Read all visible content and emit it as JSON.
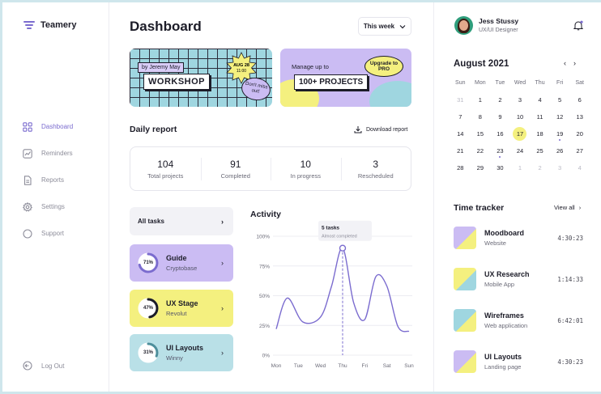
{
  "app": {
    "name": "Teamery"
  },
  "sidebar": {
    "items": [
      {
        "label": "Dashboard",
        "icon": "grid-icon"
      },
      {
        "label": "Reminders",
        "icon": "chart-icon"
      },
      {
        "label": "Reports",
        "icon": "document-icon"
      },
      {
        "label": "Settings",
        "icon": "gear-icon"
      },
      {
        "label": "Support",
        "icon": "chat-icon"
      }
    ],
    "logout_label": "Log Out"
  },
  "header": {
    "title": "Dashboard",
    "period": "This week"
  },
  "banners": {
    "workshop": {
      "by": "by Jeremy May",
      "tag": "WORKSHOP",
      "date": "AUG 28",
      "time": "11:00",
      "note": "Don't miss out!"
    },
    "pro": {
      "text": "Manage up to",
      "tag": "100+ PROJECTS",
      "cta": "Upgrade to PRO"
    }
  },
  "daily_report": {
    "title": "Daily report",
    "download_label": "Download report",
    "stats": [
      {
        "value": "104",
        "label": "Total projects"
      },
      {
        "value": "91",
        "label": "Completed"
      },
      {
        "value": "10",
        "label": "In progress"
      },
      {
        "value": "3",
        "label": "Rescheduled"
      }
    ]
  },
  "tasks": {
    "all_label": "All tasks",
    "items": [
      {
        "name": "Guide",
        "sub": "Cryptobase",
        "progress": "71%",
        "color": "#cbbcf3",
        "ring": "#7b6ccf"
      },
      {
        "name": "UX Stage",
        "sub": "Revolut",
        "progress": "47%",
        "color": "#f4f07f",
        "ring": "#1c1c28"
      },
      {
        "name": "UI Layouts",
        "sub": "Winny",
        "progress": "31%",
        "color": "#b9e0e7",
        "ring": "#4e8f9c"
      }
    ]
  },
  "activity": {
    "title": "Activity",
    "tooltip_title": "5 tasks",
    "tooltip_sub": "Almost completed"
  },
  "chart_data": {
    "type": "line",
    "title": "Activity",
    "categories": [
      "Mon",
      "Tue",
      "Wed",
      "Thu",
      "Fri",
      "Sat",
      "Sun"
    ],
    "y_ticks": [
      "100%",
      "75%",
      "50%",
      "25%",
      "0%"
    ],
    "ylim": [
      0,
      100
    ],
    "series": [
      {
        "x": [
          0,
          0.5,
          1.2,
          2.0,
          2.5,
          3.0,
          3.5,
          4.0,
          4.5,
          5.0,
          5.5,
          6.0
        ],
        "values": [
          22,
          48,
          28,
          32,
          58,
          90,
          44,
          30,
          66,
          58,
          24,
          20
        ]
      }
    ],
    "highlight_category": "Thu",
    "line_color": "#7b6ccf"
  },
  "user": {
    "name": "Jess Stussy",
    "role": "UX/UI Designer"
  },
  "calendar": {
    "title": "August 2021",
    "weekdays": [
      "Sun",
      "Mon",
      "Tue",
      "Wed",
      "Thu",
      "Fri",
      "Sat"
    ],
    "days": [
      {
        "d": "31",
        "muted": true
      },
      {
        "d": "1"
      },
      {
        "d": "2"
      },
      {
        "d": "3"
      },
      {
        "d": "4"
      },
      {
        "d": "5"
      },
      {
        "d": "6"
      },
      {
        "d": "7"
      },
      {
        "d": "8"
      },
      {
        "d": "9"
      },
      {
        "d": "10"
      },
      {
        "d": "11"
      },
      {
        "d": "12"
      },
      {
        "d": "13"
      },
      {
        "d": "14"
      },
      {
        "d": "15"
      },
      {
        "d": "16"
      },
      {
        "d": "17",
        "today": true
      },
      {
        "d": "18"
      },
      {
        "d": "19",
        "dot": true
      },
      {
        "d": "20"
      },
      {
        "d": "21"
      },
      {
        "d": "22"
      },
      {
        "d": "23",
        "dot": true
      },
      {
        "d": "24"
      },
      {
        "d": "25"
      },
      {
        "d": "26"
      },
      {
        "d": "27"
      },
      {
        "d": "28"
      },
      {
        "d": "29"
      },
      {
        "d": "30"
      },
      {
        "d": "1",
        "muted": true
      },
      {
        "d": "2",
        "muted": true
      },
      {
        "d": "3",
        "muted": true
      },
      {
        "d": "4",
        "muted": true
      }
    ]
  },
  "time_tracker": {
    "title": "Time tracker",
    "view_all": "View all",
    "items": [
      {
        "name": "Moodboard",
        "sub": "Website",
        "time": "4:30:23",
        "thumb": [
          "#cbbcf3",
          "#f4f07f"
        ]
      },
      {
        "name": "UX Research",
        "sub": "Mobile App",
        "time": "1:14:33",
        "thumb": [
          "#f4f07f",
          "#9fd6e0"
        ]
      },
      {
        "name": "Wireframes",
        "sub": "Web application",
        "time": "6:42:01",
        "thumb": [
          "#9fd6e0",
          "#f4f07f"
        ]
      },
      {
        "name": "UI Layouts",
        "sub": "Landing page",
        "time": "4:30:23",
        "thumb": [
          "#cbbcf3",
          "#f4f07f"
        ]
      }
    ]
  }
}
